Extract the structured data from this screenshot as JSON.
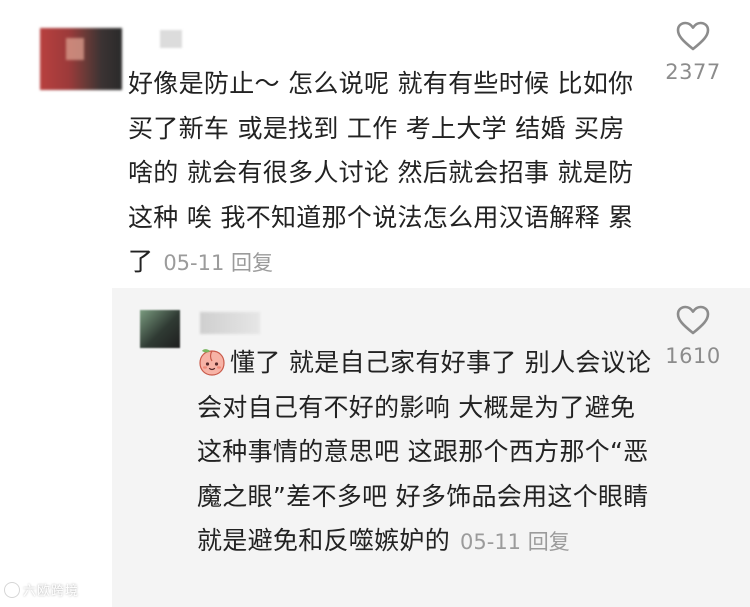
{
  "comment": {
    "text": "好像是防止～ 怎么说呢 就有有些时候 比如你买了新车 或是找到 工作 考上大学 结婚 买房啥的 就会有很多人讨论 然后就会招事 就是防这种  唉 我不知道那个说法怎么用汉语解释 累了",
    "date": "05-11",
    "reply_label": "回复",
    "like_count": "2377",
    "like_icon": "heart-outline-icon"
  },
  "reply": {
    "emoji": "peach-face-emoji",
    "text": "懂了 就是自己家有好事了 别人会议论 会对自己有不好的影响 大概是为了避免这种事情的意思吧 这跟那个西方那个“恶魔之眼”差不多吧 好多饰品会用这个眼睛 就是避免和反噬嫉妒的",
    "date": "05-11",
    "reply_label": "回复",
    "like_count": "1610",
    "like_icon": "heart-outline-icon"
  },
  "watermark": {
    "text": "六欧跨境"
  },
  "colors": {
    "text": "#222222",
    "meta": "#9b9b9b",
    "reply_bg": "#f4f4f4",
    "like": "#8c8c8c"
  }
}
